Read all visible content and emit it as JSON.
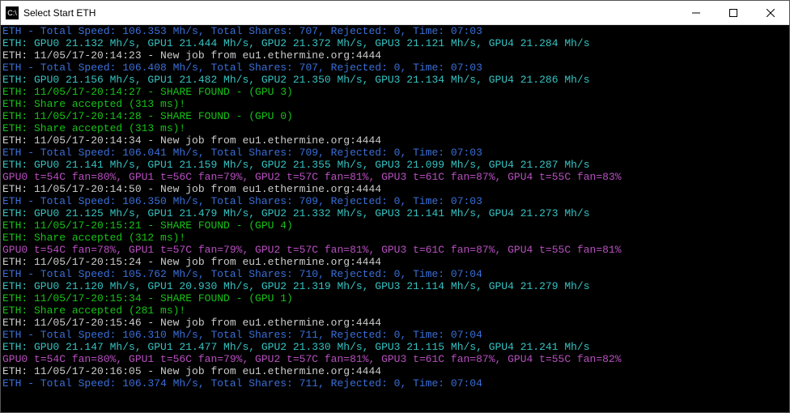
{
  "window": {
    "title": "Select Start ETH",
    "icon_glyph": "C:\\"
  },
  "controls": {
    "minimize": "—",
    "maximize": "□",
    "close": "✕"
  },
  "colors": {
    "blue": "#3a6fd8",
    "cyan": "#36c2c2",
    "white": "#cccccc",
    "green": "#17c217",
    "magenta": "#b84fc0",
    "bg": "#000000"
  },
  "lines": [
    {
      "cls": "c-blue",
      "text": "ETH - Total Speed: 106.353 Mh/s, Total Shares: 707, Rejected: 0, Time: 07:03"
    },
    {
      "cls": "c-cyan",
      "text": "ETH: GPU0 21.132 Mh/s, GPU1 21.444 Mh/s, GPU2 21.372 Mh/s, GPU3 21.121 Mh/s, GPU4 21.284 Mh/s"
    },
    {
      "cls": "c-white",
      "text": "ETH: 11/05/17-20:14:23 - New job from eu1.ethermine.org:4444"
    },
    {
      "cls": "c-blue",
      "text": "ETH - Total Speed: 106.408 Mh/s, Total Shares: 707, Rejected: 0, Time: 07:03"
    },
    {
      "cls": "c-cyan",
      "text": "ETH: GPU0 21.156 Mh/s, GPU1 21.482 Mh/s, GPU2 21.350 Mh/s, GPU3 21.134 Mh/s, GPU4 21.286 Mh/s"
    },
    {
      "cls": "c-green",
      "text": "ETH: 11/05/17-20:14:27 - SHARE FOUND - (GPU 3)"
    },
    {
      "cls": "c-green",
      "text": "ETH: Share accepted (313 ms)!"
    },
    {
      "cls": "c-green",
      "text": "ETH: 11/05/17-20:14:28 - SHARE FOUND - (GPU 0)"
    },
    {
      "cls": "c-green",
      "text": "ETH: Share accepted (313 ms)!"
    },
    {
      "cls": "c-white",
      "text": "ETH: 11/05/17-20:14:34 - New job from eu1.ethermine.org:4444"
    },
    {
      "cls": "c-blue",
      "text": "ETH - Total Speed: 106.041 Mh/s, Total Shares: 709, Rejected: 0, Time: 07:03"
    },
    {
      "cls": "c-cyan",
      "text": "ETH: GPU0 21.141 Mh/s, GPU1 21.159 Mh/s, GPU2 21.355 Mh/s, GPU3 21.099 Mh/s, GPU4 21.287 Mh/s"
    },
    {
      "cls": "c-mag",
      "text": "GPU0 t=54C fan=80%, GPU1 t=56C fan=79%, GPU2 t=57C fan=81%, GPU3 t=61C fan=87%, GPU4 t=55C fan=83%"
    },
    {
      "cls": "c-white",
      "text": "ETH: 11/05/17-20:14:50 - New job from eu1.ethermine.org:4444"
    },
    {
      "cls": "c-blue",
      "text": "ETH - Total Speed: 106.350 Mh/s, Total Shares: 709, Rejected: 0, Time: 07:03"
    },
    {
      "cls": "c-cyan",
      "text": "ETH: GPU0 21.125 Mh/s, GPU1 21.479 Mh/s, GPU2 21.332 Mh/s, GPU3 21.141 Mh/s, GPU4 21.273 Mh/s"
    },
    {
      "cls": "c-green",
      "text": "ETH: 11/05/17-20:15:21 - SHARE FOUND - (GPU 4)"
    },
    {
      "cls": "c-green",
      "text": "ETH: Share accepted (312 ms)!"
    },
    {
      "cls": "c-mag",
      "text": "GPU0 t=54C fan=78%, GPU1 t=57C fan=79%, GPU2 t=57C fan=81%, GPU3 t=61C fan=87%, GPU4 t=55C fan=81%"
    },
    {
      "cls": "c-white",
      "text": "ETH: 11/05/17-20:15:24 - New job from eu1.ethermine.org:4444"
    },
    {
      "cls": "c-blue",
      "text": "ETH - Total Speed: 105.762 Mh/s, Total Shares: 710, Rejected: 0, Time: 07:04"
    },
    {
      "cls": "c-cyan",
      "text": "ETH: GPU0 21.120 Mh/s, GPU1 20.930 Mh/s, GPU2 21.319 Mh/s, GPU3 21.114 Mh/s, GPU4 21.279 Mh/s"
    },
    {
      "cls": "c-green",
      "text": "ETH: 11/05/17-20:15:34 - SHARE FOUND - (GPU 1)"
    },
    {
      "cls": "c-green",
      "text": "ETH: Share accepted (281 ms)!"
    },
    {
      "cls": "c-white",
      "text": "ETH: 11/05/17-20:15:46 - New job from eu1.ethermine.org:4444"
    },
    {
      "cls": "c-blue",
      "text": "ETH - Total Speed: 106.310 Mh/s, Total Shares: 711, Rejected: 0, Time: 07:04"
    },
    {
      "cls": "c-cyan",
      "text": "ETH: GPU0 21.147 Mh/s, GPU1 21.477 Mh/s, GPU2 21.330 Mh/s, GPU3 21.115 Mh/s, GPU4 21.241 Mh/s"
    },
    {
      "cls": "c-mag",
      "text": "GPU0 t=54C fan=80%, GPU1 t=56C fan=79%, GPU2 t=57C fan=81%, GPU3 t=61C fan=87%, GPU4 t=55C fan=82%"
    },
    {
      "cls": "c-white",
      "text": "ETH: 11/05/17-20:16:05 - New job from eu1.ethermine.org:4444"
    },
    {
      "cls": "c-blue",
      "text": "ETH - Total Speed: 106.374 Mh/s, Total Shares: 711, Rejected: 0, Time: 07:04"
    }
  ]
}
